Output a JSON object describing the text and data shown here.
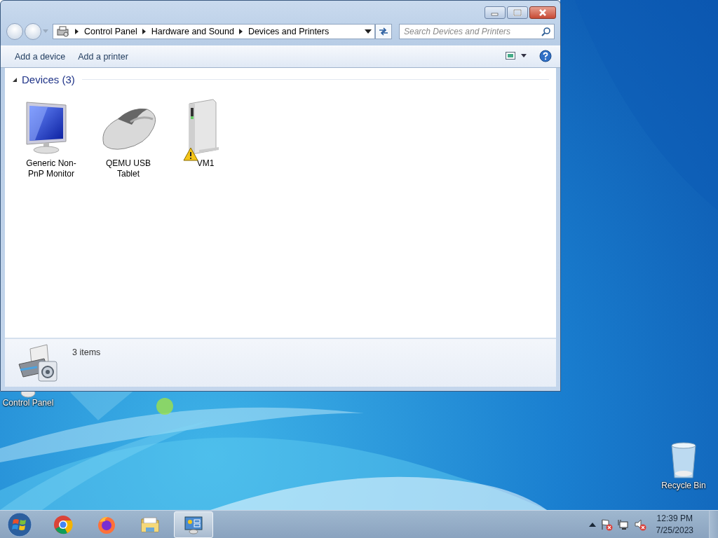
{
  "window": {
    "breadcrumb": [
      "Control Panel",
      "Hardware and Sound",
      "Devices and Printers"
    ],
    "search": {
      "placeholder": "Search Devices and Printers"
    },
    "toolbar": [
      "Add a device",
      "Add a printer"
    ],
    "group": {
      "title": "Devices (3)",
      "expanded": true
    },
    "devices": [
      {
        "name": "Generic Non-PnP Monitor",
        "kind": "monitor",
        "warning": false
      },
      {
        "name": "QEMU USB Tablet",
        "kind": "mouse",
        "warning": false
      },
      {
        "name": "VM1",
        "kind": "drive",
        "warning": true
      }
    ],
    "status": "3 items"
  },
  "desktop_icons": [
    {
      "label": "Control Panel",
      "kind": "control-panel"
    },
    {
      "label": "Recycle Bin",
      "kind": "recycle-bin"
    }
  ],
  "taskbar": {
    "apps": [
      {
        "kind": "chrome",
        "selected": false
      },
      {
        "kind": "firefox",
        "selected": false
      },
      {
        "kind": "explorer",
        "selected": false
      },
      {
        "kind": "devices",
        "selected": true
      }
    ],
    "tray": [
      {
        "kind": "flag"
      },
      {
        "kind": "network"
      },
      {
        "kind": "volume"
      }
    ],
    "time": "12:39 PM",
    "date": "7/25/2023"
  }
}
